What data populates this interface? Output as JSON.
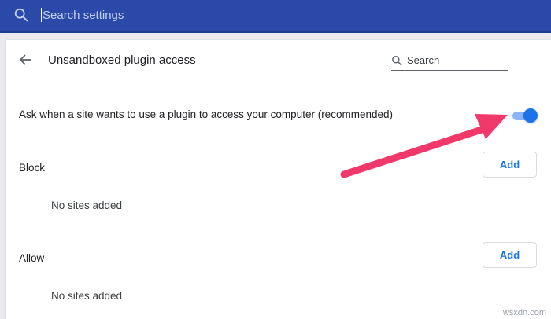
{
  "header": {
    "search_placeholder": "Search settings",
    "bg_color": "#2a49a8",
    "search_icon": "search-icon"
  },
  "page": {
    "title": "Unsandboxed plugin access",
    "back_icon": "arrow-back-icon",
    "search_label": "Search",
    "search_icon": "search-icon"
  },
  "setting": {
    "label": "Ask when a site wants to use a plugin to access your computer (recommended)",
    "toggle_on": true,
    "accent": "#1a73e8"
  },
  "block": {
    "label": "Block",
    "add_label": "Add",
    "empty": "No sites added"
  },
  "allow": {
    "label": "Allow",
    "add_label": "Add",
    "empty": "No sites added"
  },
  "annotation": {
    "arrow_color": "#f0386b"
  },
  "watermark": "wsxdn.com"
}
